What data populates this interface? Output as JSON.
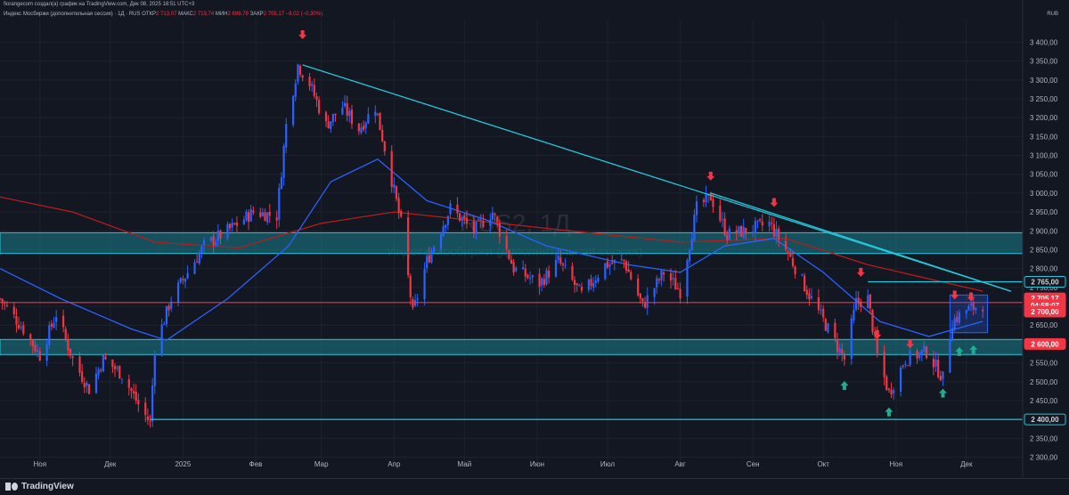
{
  "header": {
    "attribution": "fiorangecom создал(а) график на TradingView.com, Дек 08, 2025 18:51 UTC+3",
    "symbol": "Индекс Мосбиржи (дополнительная сессия) · 1Д · RUS",
    "o_label": "ОТКР",
    "o_value": "2 713,07",
    "h_label": "МАКС",
    "h_value": "2 719,74",
    "l_label": "МИН",
    "l_value": "2 699,79",
    "c_label": "ЗАКР",
    "c_value": "2 705,17",
    "change": "−8,02 (−0,30%)",
    "currency": "RUB"
  },
  "watermark": {
    "symbol": "RUS2, 1Д",
    "description": "Индекс Мосбиржи (дополнительная сессия)"
  },
  "branding": {
    "logo_text": "TradingView"
  },
  "colors": {
    "background": "#131722",
    "grid": "#1e222d",
    "up": "#2962ff",
    "down": "#f23645",
    "trendline": "#26c6da",
    "zone": "#1a7f8c",
    "ma_fast": "#2962ff",
    "ma_slow": "#b71c1c"
  },
  "chart_data": {
    "type": "candlestick",
    "title": "",
    "ylim": [
      2280,
      3460
    ],
    "y_ticks": [
      "2 300,00",
      "2 350,00",
      "2 400,00",
      "2 450,00",
      "2 500,00",
      "2 550,00",
      "2 600,00",
      "2 650,00",
      "2 700,00",
      "2 750,00",
      "2 800,00",
      "2 850,00",
      "2 900,00",
      "2 950,00",
      "3 000,00",
      "3 050,00",
      "3 100,00",
      "3 150,00",
      "3 200,00",
      "3 250,00",
      "3 300,00",
      "3 350,00",
      "3 400,00"
    ],
    "x_ticks": [
      {
        "label": "Ноя",
        "date": "2024-11-01"
      },
      {
        "label": "Дек",
        "date": "2024-12-01"
      },
      {
        "label": "2025",
        "date": "2025-01-01"
      },
      {
        "label": "Фев",
        "date": "2025-02-01"
      },
      {
        "label": "Мар",
        "date": "2025-03-01"
      },
      {
        "label": "Апр",
        "date": "2025-04-01"
      },
      {
        "label": "Май",
        "date": "2025-05-01"
      },
      {
        "label": "Июн",
        "date": "2025-06-01"
      },
      {
        "label": "Июл",
        "date": "2025-07-01"
      },
      {
        "label": "Авг",
        "date": "2025-08-01"
      },
      {
        "label": "Сен",
        "date": "2025-09-01"
      },
      {
        "label": "Окт",
        "date": "2025-10-01"
      },
      {
        "label": "Ноя",
        "date": "2025-11-01"
      },
      {
        "label": "Дек",
        "date": "2025-12-01"
      }
    ],
    "x_range": [
      "2024-10-15",
      "2025-12-25"
    ],
    "close_path": [
      {
        "date": "2024-10-15",
        "value": 2720
      },
      {
        "date": "2024-10-25",
        "value": 2640
      },
      {
        "date": "2024-11-01",
        "value": 2570
      },
      {
        "date": "2024-11-08",
        "value": 2680
      },
      {
        "date": "2024-11-15",
        "value": 2560
      },
      {
        "date": "2024-11-22",
        "value": 2480
      },
      {
        "date": "2024-11-28",
        "value": 2560
      },
      {
        "date": "2024-12-06",
        "value": 2520
      },
      {
        "date": "2024-12-13",
        "value": 2440
      },
      {
        "date": "2024-12-18",
        "value": 2390
      },
      {
        "date": "2024-12-20",
        "value": 2590
      },
      {
        "date": "2024-12-27",
        "value": 2720
      },
      {
        "date": "2025-01-10",
        "value": 2860
      },
      {
        "date": "2025-01-20",
        "value": 2900
      },
      {
        "date": "2025-01-31",
        "value": 2950
      },
      {
        "date": "2025-02-10",
        "value": 2940
      },
      {
        "date": "2025-02-14",
        "value": 3180
      },
      {
        "date": "2025-02-19",
        "value": 3340
      },
      {
        "date": "2025-02-24",
        "value": 3290
      },
      {
        "date": "2025-03-03",
        "value": 3180
      },
      {
        "date": "2025-03-10",
        "value": 3230
      },
      {
        "date": "2025-03-17",
        "value": 3170
      },
      {
        "date": "2025-03-24",
        "value": 3230
      },
      {
        "date": "2025-03-28",
        "value": 3120
      },
      {
        "date": "2025-04-04",
        "value": 2920
      },
      {
        "date": "2025-04-09",
        "value": 2680
      },
      {
        "date": "2025-04-15",
        "value": 2820
      },
      {
        "date": "2025-04-25",
        "value": 2960
      },
      {
        "date": "2025-05-05",
        "value": 2900
      },
      {
        "date": "2025-05-13",
        "value": 2950
      },
      {
        "date": "2025-05-22",
        "value": 2800
      },
      {
        "date": "2025-06-02",
        "value": 2760
      },
      {
        "date": "2025-06-10",
        "value": 2820
      },
      {
        "date": "2025-06-20",
        "value": 2730
      },
      {
        "date": "2025-06-30",
        "value": 2810
      },
      {
        "date": "2025-07-08",
        "value": 2820
      },
      {
        "date": "2025-07-16",
        "value": 2700
      },
      {
        "date": "2025-07-25",
        "value": 2790
      },
      {
        "date": "2025-08-01",
        "value": 2740
      },
      {
        "date": "2025-08-08",
        "value": 2960
      },
      {
        "date": "2025-08-14",
        "value": 2990
      },
      {
        "date": "2025-08-21",
        "value": 2890
      },
      {
        "date": "2025-08-29",
        "value": 2900
      },
      {
        "date": "2025-09-08",
        "value": 2920
      },
      {
        "date": "2025-09-16",
        "value": 2840
      },
      {
        "date": "2025-09-25",
        "value": 2730
      },
      {
        "date": "2025-10-03",
        "value": 2640
      },
      {
        "date": "2025-10-10",
        "value": 2560
      },
      {
        "date": "2025-10-15",
        "value": 2710
      },
      {
        "date": "2025-10-20",
        "value": 2720
      },
      {
        "date": "2025-10-24",
        "value": 2570
      },
      {
        "date": "2025-10-29",
        "value": 2470
      },
      {
        "date": "2025-11-05",
        "value": 2560
      },
      {
        "date": "2025-11-14",
        "value": 2580
      },
      {
        "date": "2025-11-21",
        "value": 2510
      },
      {
        "date": "2025-11-25",
        "value": 2660
      },
      {
        "date": "2025-12-01",
        "value": 2690
      },
      {
        "date": "2025-12-08",
        "value": 2705
      }
    ],
    "ma_fast_path": [
      {
        "date": "2024-10-15",
        "value": 2800
      },
      {
        "date": "2024-11-10",
        "value": 2720
      },
      {
        "date": "2024-12-10",
        "value": 2640
      },
      {
        "date": "2024-12-25",
        "value": 2610
      },
      {
        "date": "2025-01-20",
        "value": 2720
      },
      {
        "date": "2025-02-15",
        "value": 2860
      },
      {
        "date": "2025-03-05",
        "value": 3030
      },
      {
        "date": "2025-03-25",
        "value": 3090
      },
      {
        "date": "2025-04-15",
        "value": 2980
      },
      {
        "date": "2025-05-10",
        "value": 2930
      },
      {
        "date": "2025-06-05",
        "value": 2860
      },
      {
        "date": "2025-07-10",
        "value": 2810
      },
      {
        "date": "2025-08-01",
        "value": 2790
      },
      {
        "date": "2025-08-20",
        "value": 2860
      },
      {
        "date": "2025-09-10",
        "value": 2880
      },
      {
        "date": "2025-10-01",
        "value": 2790
      },
      {
        "date": "2025-10-25",
        "value": 2660
      },
      {
        "date": "2025-11-15",
        "value": 2620
      },
      {
        "date": "2025-12-08",
        "value": 2660
      }
    ],
    "ma_slow_path": [
      {
        "date": "2024-10-15",
        "value": 2990
      },
      {
        "date": "2024-11-15",
        "value": 2950
      },
      {
        "date": "2024-12-20",
        "value": 2870
      },
      {
        "date": "2025-01-25",
        "value": 2855
      },
      {
        "date": "2025-03-01",
        "value": 2920
      },
      {
        "date": "2025-04-01",
        "value": 2950
      },
      {
        "date": "2025-05-01",
        "value": 2930
      },
      {
        "date": "2025-06-15",
        "value": 2900
      },
      {
        "date": "2025-08-01",
        "value": 2870
      },
      {
        "date": "2025-09-15",
        "value": 2880
      },
      {
        "date": "2025-10-20",
        "value": 2810
      },
      {
        "date": "2025-12-08",
        "value": 2740
      }
    ],
    "zones": [
      {
        "from": 2840,
        "to": 2895
      },
      {
        "from": 2572,
        "to": 2612
      }
    ],
    "horizontal_lines": [
      {
        "value": 2710,
        "color": "#f23645",
        "from": "2024-10-15"
      },
      {
        "value": 2400,
        "color": "#26c6da",
        "from": "2024-12-18"
      },
      {
        "value": 2765,
        "color": "#26c6da",
        "from": "2025-10-20"
      }
    ],
    "trendlines": [
      {
        "from": {
          "date": "2025-02-21",
          "value": 3340
        },
        "to": {
          "date": "2025-12-20",
          "value": 2740
        }
      },
      {
        "from": {
          "date": "2025-08-14",
          "value": 3000
        },
        "to": {
          "date": "2025-12-20",
          "value": 2740
        }
      }
    ],
    "box": {
      "from_date": "2025-11-24",
      "to_date": "2025-12-10",
      "from": 2630,
      "to": 2730
    },
    "down_arrows": [
      {
        "date": "2025-02-21",
        "value": 3420
      },
      {
        "date": "2025-08-14",
        "value": 3045
      },
      {
        "date": "2025-09-10",
        "value": 2975
      },
      {
        "date": "2025-10-17",
        "value": 2790
      },
      {
        "date": "2025-10-24",
        "value": 2625
      },
      {
        "date": "2025-11-07",
        "value": 2600
      },
      {
        "date": "2025-11-26",
        "value": 2730
      },
      {
        "date": "2025-12-03",
        "value": 2725
      }
    ],
    "up_arrows": [
      {
        "date": "2025-10-10",
        "value": 2490
      },
      {
        "date": "2025-10-29",
        "value": 2420
      },
      {
        "date": "2025-11-21",
        "value": 2470
      },
      {
        "date": "2025-11-28",
        "value": 2580
      },
      {
        "date": "2025-12-04",
        "value": 2585
      }
    ],
    "price_labels": [
      {
        "text": "2 765,00",
        "value": 2765,
        "bg": "#131722",
        "border": "#26c6da",
        "color": "#d1d4dc"
      },
      {
        "text": "2 705,17",
        "value": 2721,
        "bg": "#f23645",
        "border": "#f23645",
        "color": "#ffffff"
      },
      {
        "text": "04:58:07",
        "value": 2703,
        "bg": "#f23645",
        "border": "#f23645",
        "color": "#ffffff"
      },
      {
        "text": "2 700,00",
        "value": 2686,
        "bg": "#f23645",
        "border": "#f23645",
        "color": "#ffffff"
      },
      {
        "text": "2 600,00",
        "value": 2600,
        "bg": "#f23645",
        "border": "#f23645",
        "color": "#ffffff"
      },
      {
        "text": "2 400,00",
        "value": 2400,
        "bg": "#131722",
        "border": "#26c6da",
        "color": "#d1d4dc"
      }
    ]
  }
}
